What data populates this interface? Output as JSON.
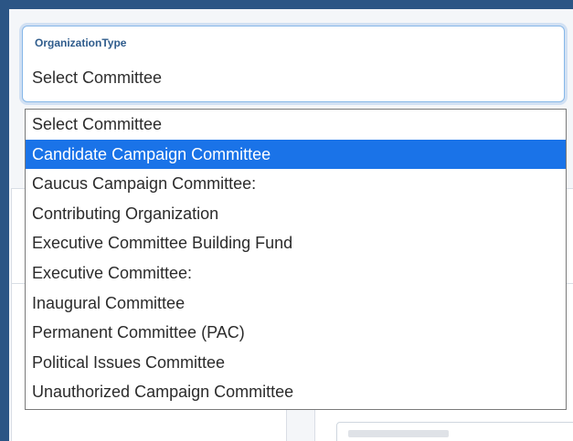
{
  "field": {
    "label": "OrganizationType",
    "value": "Select Committee"
  },
  "dropdown": {
    "highlighted_index": 1,
    "options": [
      "Select Committee",
      "Candidate Campaign Committee",
      "Caucus Campaign Committee:",
      "Contributing Organization",
      "Executive Committee Building Fund",
      "Executive Committee:",
      "Inaugural Committee",
      "Permanent Committee (PAC)",
      "Political Issues Committee",
      "Unauthorized Campaign Committee"
    ]
  },
  "colors": {
    "page_border": "#2b5585",
    "label": "#2f5c8c",
    "highlight": "#1a73e8",
    "focus_ring": "#86b7e8"
  }
}
